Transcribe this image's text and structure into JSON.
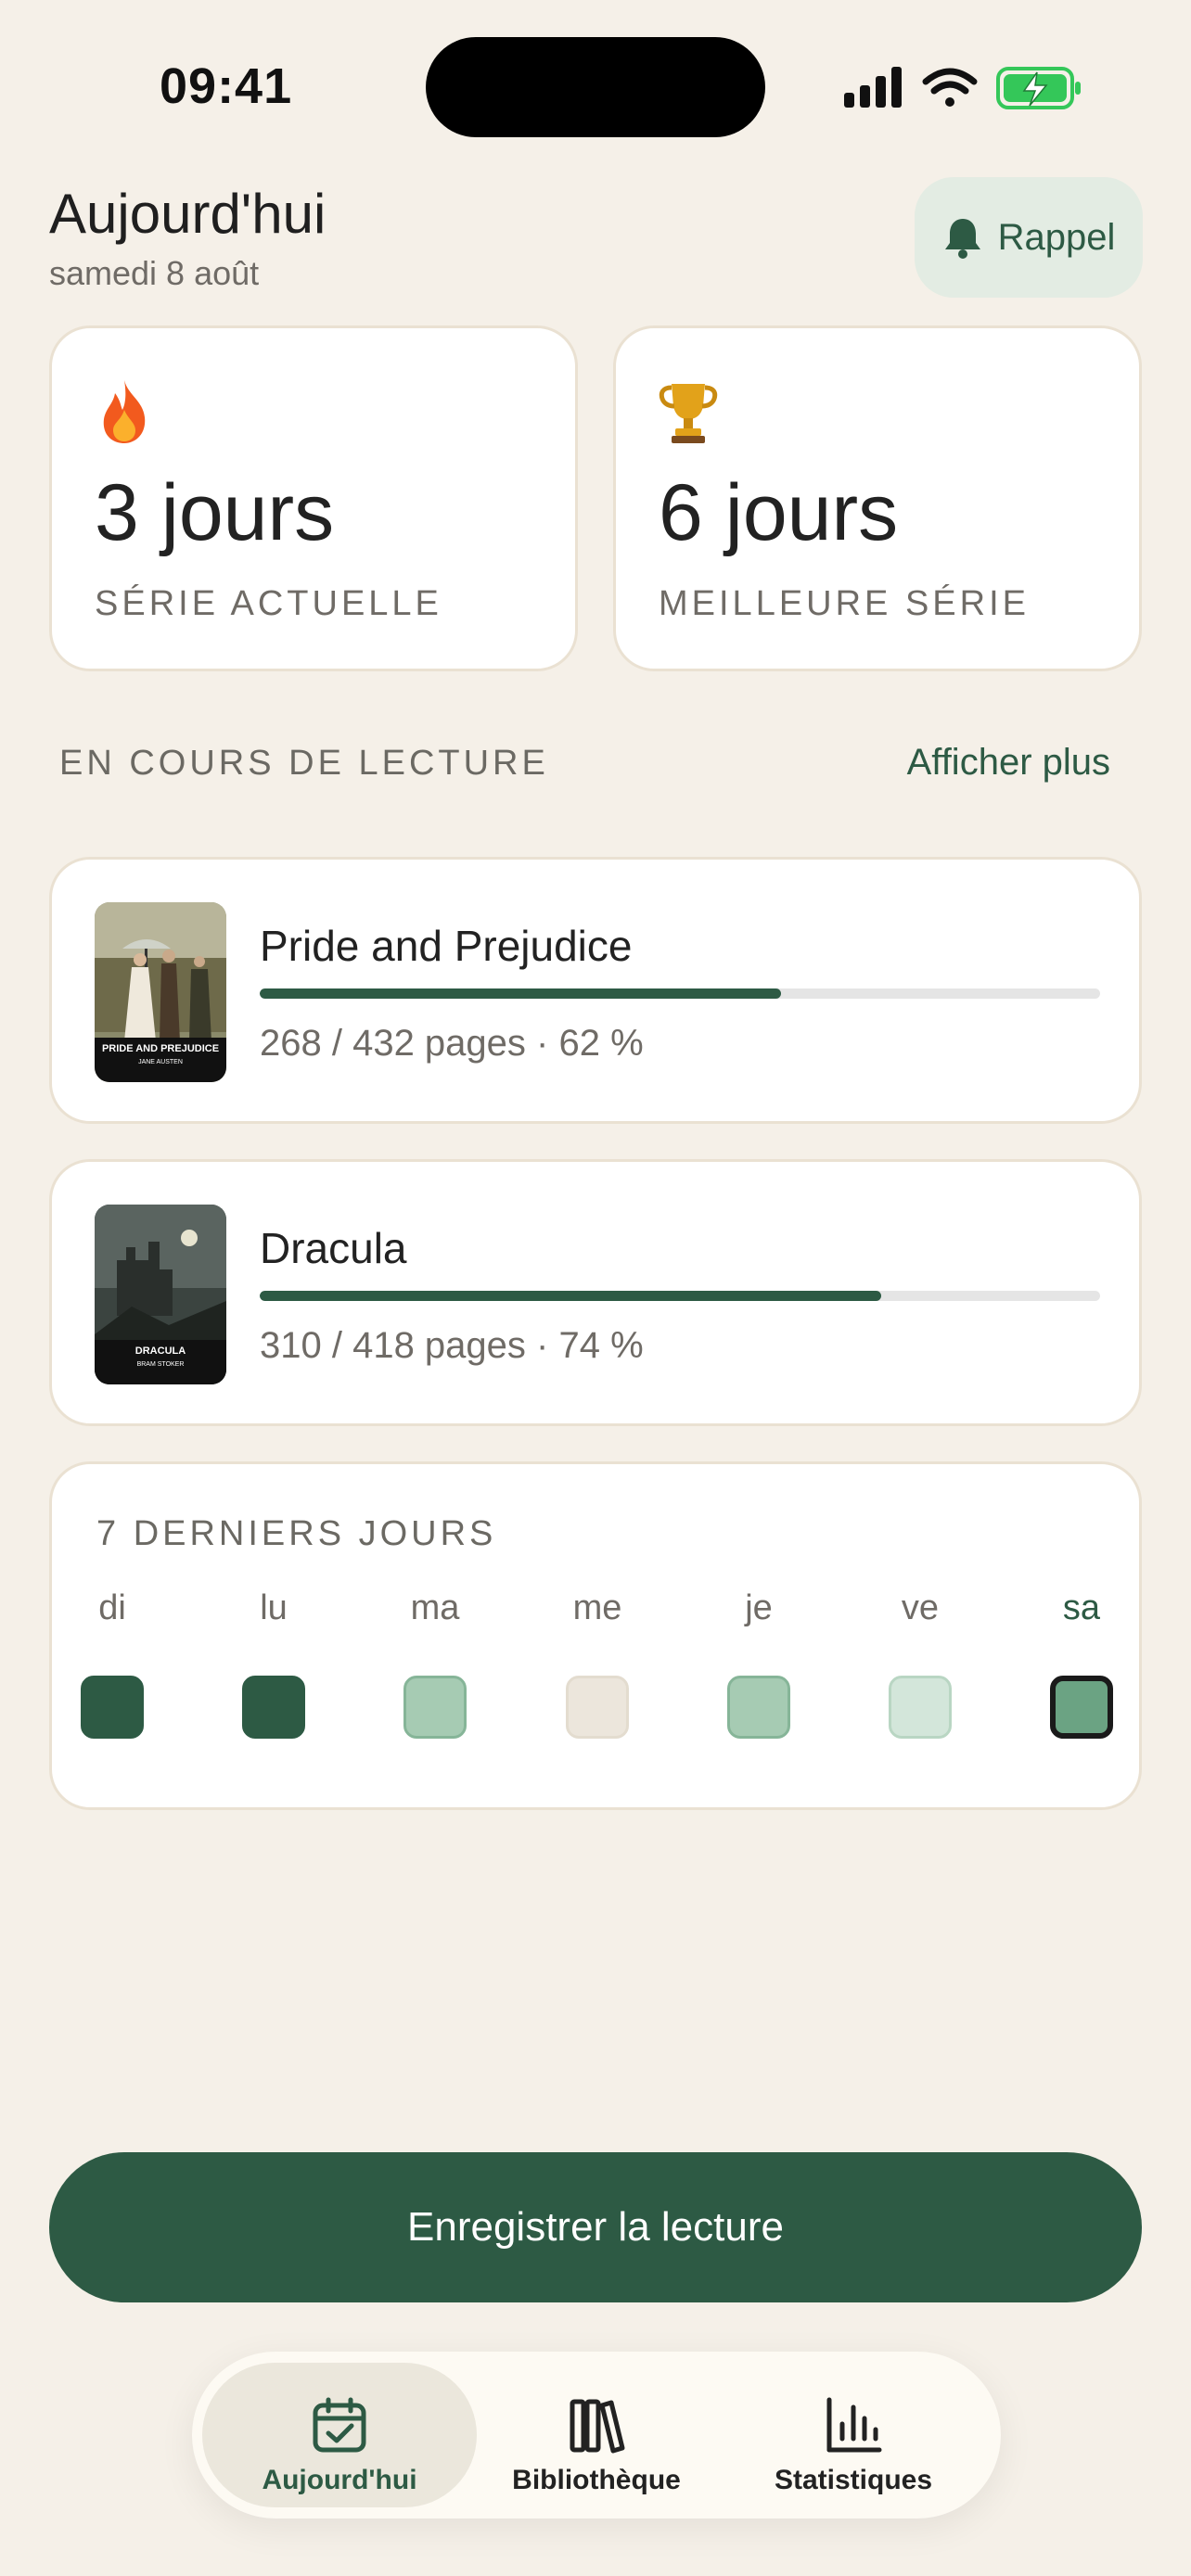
{
  "status_bar": {
    "time": "09:41"
  },
  "header": {
    "title": "Aujourd'hui",
    "date": "samedi 8 août",
    "reminder_label": "Rappel"
  },
  "streaks": {
    "current": {
      "icon": "fire-icon",
      "value": "3 jours",
      "label": "SÉRIE ACTUELLE"
    },
    "best": {
      "icon": "trophy-icon",
      "value": "6 jours",
      "label": "MEILLEURE SÉRIE"
    }
  },
  "reading": {
    "section_label": "EN COURS DE LECTURE",
    "show_more": "Afficher plus",
    "books": [
      {
        "title": "Pride and Prejudice",
        "meta": "268 / 432 pages · 62 %",
        "progress": 0.62,
        "cover_caption": "PRIDE AND PREJUDICE",
        "cover_author": "JANE AUSTEN"
      },
      {
        "title": "Dracula",
        "meta": "310 / 418 pages · 74 %",
        "progress": 0.74,
        "cover_caption": "DRACULA",
        "cover_author": "BRAM STOKER"
      }
    ]
  },
  "week": {
    "label": "7 DERNIERS JOURS",
    "days": [
      {
        "label": "di",
        "level": 4
      },
      {
        "label": "lu",
        "level": 4
      },
      {
        "label": "ma",
        "level": 2
      },
      {
        "label": "me",
        "level": 0
      },
      {
        "label": "je",
        "level": 2
      },
      {
        "label": "ve",
        "level": 1
      },
      {
        "label": "sa",
        "level": 3,
        "today": true
      }
    ]
  },
  "cta": {
    "label": "Enregistrer la lecture"
  },
  "tabs": [
    {
      "label": "Aujourd'hui",
      "icon": "calendar-check-icon",
      "active": true
    },
    {
      "label": "Bibliothèque",
      "icon": "books-icon",
      "active": false
    },
    {
      "label": "Statistiques",
      "icon": "bar-chart-icon",
      "active": false
    }
  ],
  "colors": {
    "accent": "#2d5a44",
    "background": "#f5f0e8",
    "level_colors": [
      "#ece6dc",
      "#d3e6da",
      "#a6cbb3",
      "#6ba383",
      "#2d5a44"
    ]
  }
}
